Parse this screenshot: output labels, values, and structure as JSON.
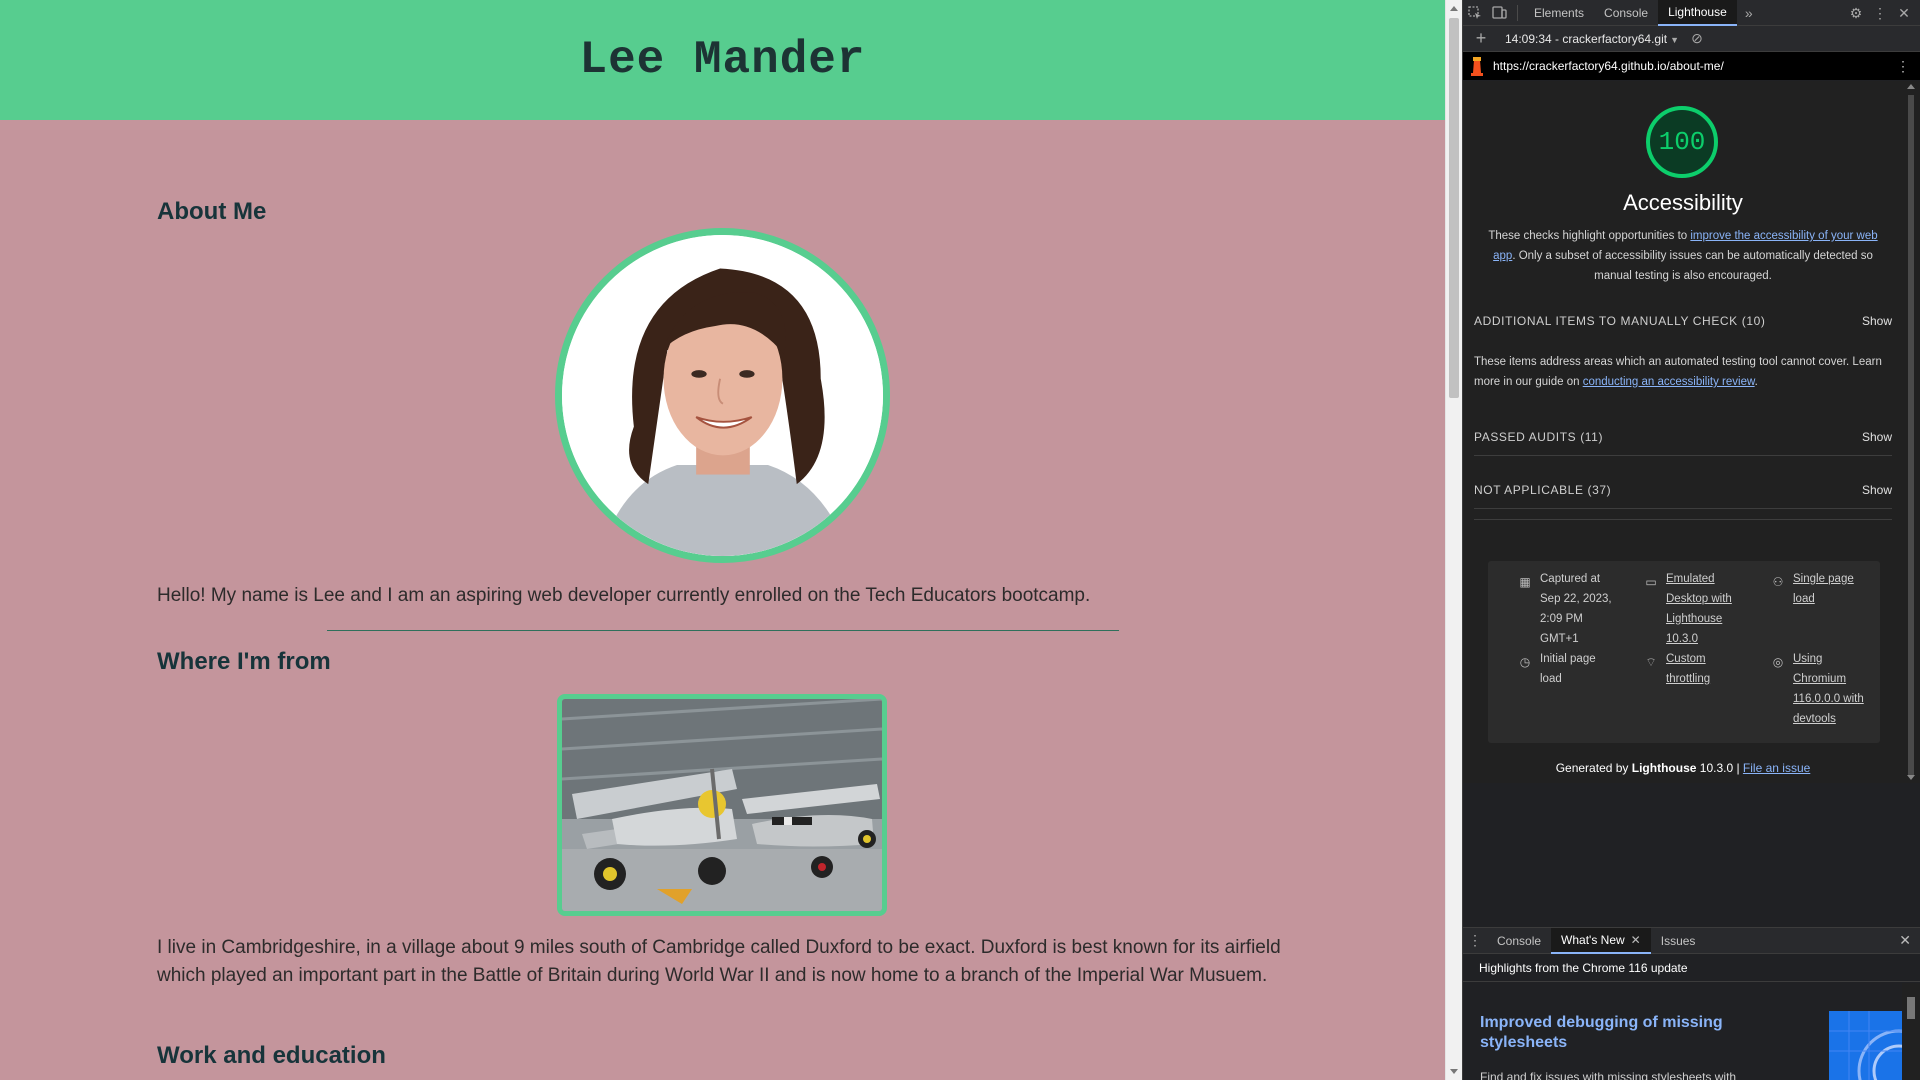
{
  "site": {
    "title": "Lee Mander",
    "about_heading": "About Me",
    "intro": "Hello! My name is Lee and I am an aspiring web developer currently enrolled on the Tech Educators bootcamp.",
    "from_heading": "Where I'm from",
    "from_text": "I live in Cambridgeshire, in a village about 9 miles south of Cambridge called Duxford to be exact. Duxford is best known for its airfield which played an important part in the Battle of Britain during World War II and is now home to a branch of the Imperial War Musuem.",
    "work_heading": "Work and education"
  },
  "devtools": {
    "tabs": [
      "Elements",
      "Console",
      "Lighthouse"
    ],
    "active_tab": "Lighthouse",
    "report_selector": "14:09:34 - crackerfactory64.git",
    "url": "https://crackerfactory64.github.io/about-me/"
  },
  "lighthouse": {
    "score": "100",
    "category": "Accessibility",
    "desc_pre": "These checks highlight opportunities to ",
    "desc_link": "improve the accessibility of your web app",
    "desc_post": ". Only a subset of accessibility issues can be automatically detected so manual testing is also encouraged.",
    "manual_group": "ADDITIONAL ITEMS TO MANUALLY CHECK (10)",
    "manual_desc_pre": "These items address areas which an automated testing tool cannot cover. Learn more in our guide on ",
    "manual_desc_link": "conducting an accessibility review",
    "manual_desc_post": ".",
    "passed_group": "PASSED AUDITS (11)",
    "na_group": "NOT APPLICABLE (37)",
    "show_label": "Show",
    "meta": {
      "captured": "Captured at Sep 22, 2023, 2:09 PM GMT+1",
      "emulated": "Emulated Desktop with Lighthouse 10.3.0",
      "single_page": "Single page load",
      "initial_load": "Initial page load",
      "throttling": "Custom throttling",
      "chromium": "Using Chromium 116.0.0.0 with devtools"
    },
    "generated_pre": "Generated by ",
    "generated_brand": "Lighthouse",
    "generated_version": " 10.3.0 | ",
    "file_issue": "File an issue"
  },
  "drawer": {
    "tabs": [
      "Console",
      "What's New",
      "Issues"
    ],
    "active_tab": "What's New",
    "header": "Highlights from the Chrome 116 update",
    "headline": "Improved debugging of missing stylesheets",
    "desc": "Find and fix issues with missing stylesheets with"
  }
}
